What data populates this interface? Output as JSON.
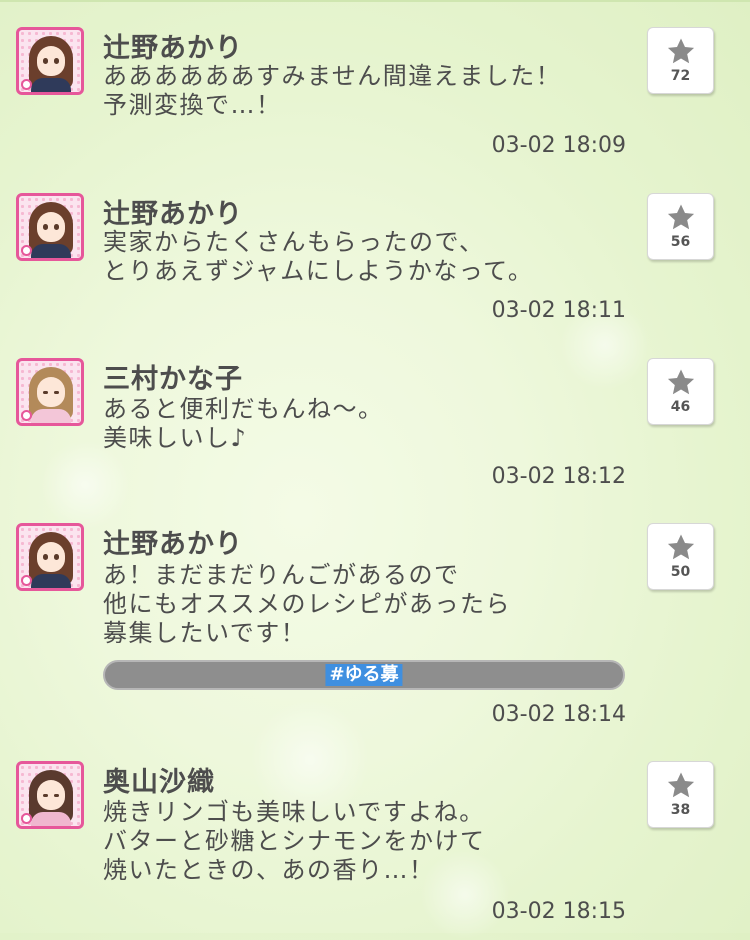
{
  "colors": {
    "accent_pink": "#e6579a",
    "hashtag_blue": "#3f8fe0",
    "bar_gray": "#8e8e8e",
    "background_green": "#eef8dc"
  },
  "posts": [
    {
      "author": "辻野あかり",
      "avatar_icon": "akari-avatar",
      "lines": [
        "ああああああすみません間違えました！",
        "予測変換で…！"
      ],
      "timestamp": "03-02 18:09",
      "likes": "72"
    },
    {
      "author": "辻野あかり",
      "avatar_icon": "akari-avatar",
      "lines": [
        "実家からたくさんもらったので、",
        "とりあえずジャムにしようかなって。"
      ],
      "timestamp": "03-02 18:11",
      "likes": "56"
    },
    {
      "author": "三村かな子",
      "avatar_icon": "kanako-avatar",
      "lines": [
        "あると便利だもんね～。",
        "美味しいし♪"
      ],
      "timestamp": "03-02 18:12",
      "likes": "46"
    },
    {
      "author": "辻野あかり",
      "avatar_icon": "akari-avatar",
      "lines": [
        "あ！まだまだりんごがあるので",
        "他にもオススメのレシピがあったら",
        "募集したいです！"
      ],
      "hashtag": "#ゆる募",
      "timestamp": "03-02 18:14",
      "likes": "50"
    },
    {
      "author": "奥山沙織",
      "avatar_icon": "saori-avatar",
      "lines": [
        "焼きリンゴも美味しいですよね。",
        "バターと砂糖とシナモンをかけて",
        "焼いたときの、あの香り…！"
      ],
      "timestamp": "03-02 18:15",
      "likes": "38"
    }
  ]
}
